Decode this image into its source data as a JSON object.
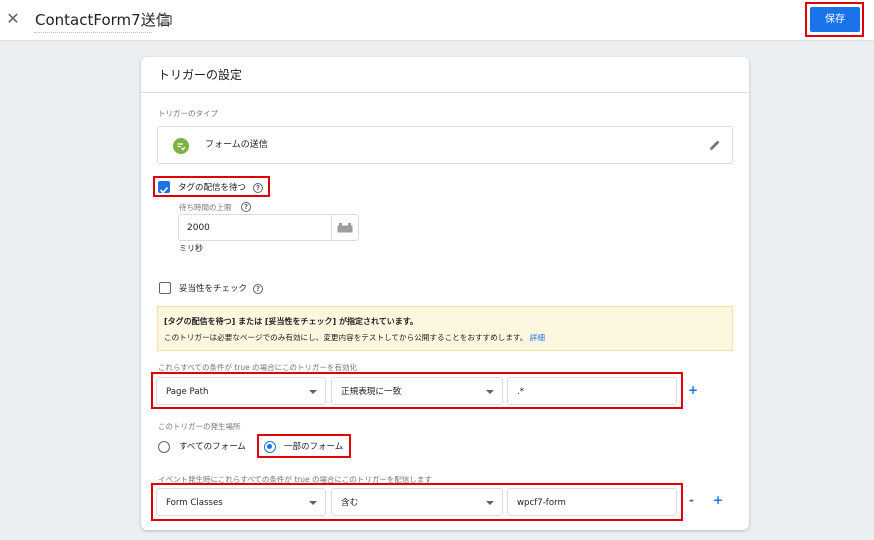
{
  "header": {
    "close_glyph": "✕",
    "title": "ContactForm7送信",
    "save_label": "保存"
  },
  "card": {
    "title": "トリガーの設定",
    "trigger_type_label": "トリガーのタイプ",
    "trigger_type_name": "フォームの送信",
    "wait_for_tags": {
      "label": "タグの配信を待つ",
      "checked": true,
      "timeout_label": "待ち時間の上限",
      "timeout_value": "2000",
      "unit": "ミリ秒"
    },
    "check_validation": {
      "label": "妥当性をチェック",
      "checked": false
    },
    "notice": {
      "title": "[タグの配信を待つ] または [妥当性をチェック] が指定されています。",
      "body": "このトリガーは必要なページでのみ有効にし、変更内容をテストしてから公開することをおすすめします。",
      "link": "詳細"
    },
    "enable_conditions": {
      "label": "これらすべての条件が true の場合にこのトリガーを有効化",
      "variable": "Page Path",
      "operator": "正規表現に一致",
      "value": ".*"
    },
    "fires_on": {
      "label": "このトリガーの発生場所",
      "options": [
        "すべてのフォーム",
        "一部のフォーム"
      ],
      "selected": "一部のフォーム"
    },
    "fire_conditions": {
      "label": "イベント発生時にこれらすべての条件が true の場合にこのトリガーを配信します",
      "variable": "Form Classes",
      "operator": "含む",
      "value": "wpcf7-form"
    }
  },
  "colors": {
    "accent": "#1a73e8",
    "highlight": "#e00000",
    "notice_bg": "#fef7e0",
    "form_icon": "#7cb342"
  },
  "icons": [
    "close-icon",
    "folder-icon",
    "form-submit-icon",
    "pencil-icon",
    "help-icon",
    "variable-picker-icon",
    "chevron-down-icon"
  ]
}
